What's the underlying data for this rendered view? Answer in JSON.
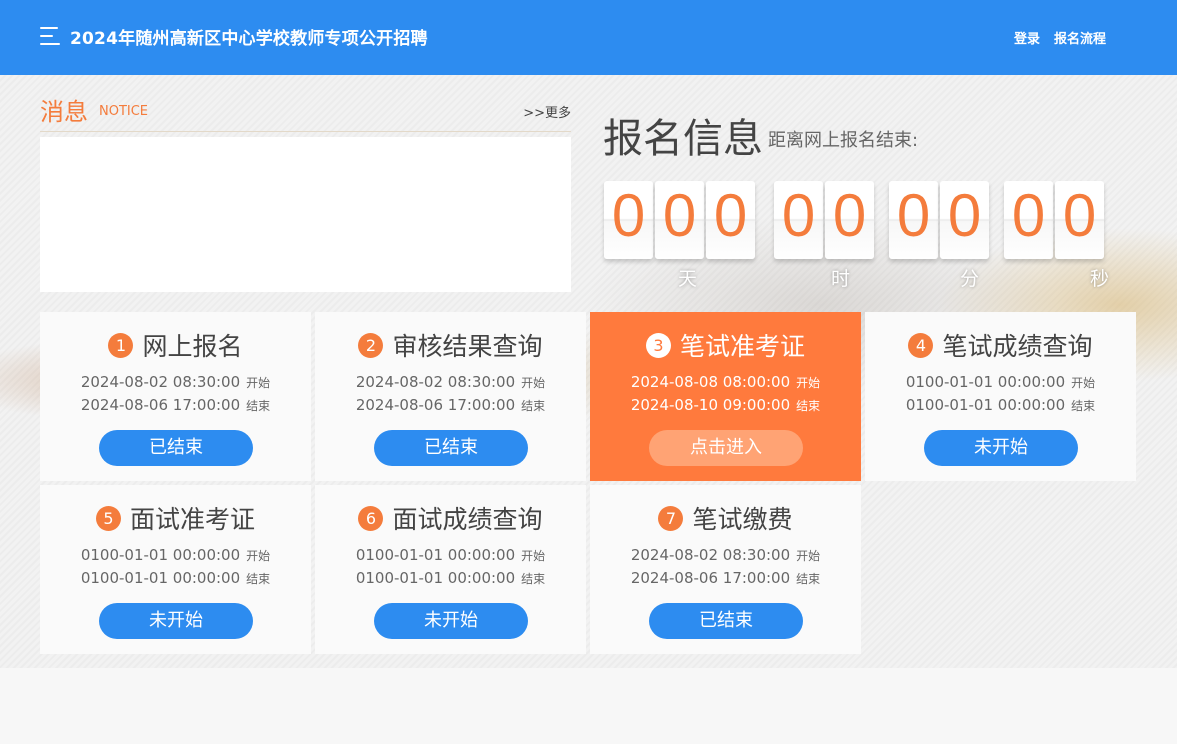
{
  "header": {
    "menu_icon": "hamburger-menu-icon",
    "title": "2024年随州高新区中心学校教师专项公开招聘",
    "login_label": "登录",
    "process_label": "报名流程",
    "bar_color": "#2d8cf0"
  },
  "notice": {
    "title": "消息",
    "subtitle": "NOTICE",
    "more_label": ">>更多"
  },
  "registration": {
    "title": "报名信息",
    "subtitle": "距离网上报名结束:",
    "countdown": {
      "days": [
        "0",
        "0",
        "0"
      ],
      "hours": [
        "0",
        "0"
      ],
      "minutes": [
        "0",
        "0"
      ],
      "seconds": [
        "0",
        "0"
      ],
      "unit_days": "天",
      "unit_hours": "时",
      "unit_minutes": "分",
      "unit_seconds": "秒"
    }
  },
  "start_tag": "开始",
  "end_tag": "结束",
  "accent_color": "#f47c3c",
  "steps": [
    {
      "num": "1",
      "name": "网上报名",
      "start": "2024-08-02 08:30:00",
      "end": "2024-08-06 17:00:00",
      "button": "已结束",
      "active": false
    },
    {
      "num": "2",
      "name": "审核结果查询",
      "start": "2024-08-02 08:30:00",
      "end": "2024-08-06 17:00:00",
      "button": "已结束",
      "active": false
    },
    {
      "num": "3",
      "name": "笔试准考证",
      "start": "2024-08-08 08:00:00",
      "end": "2024-08-10 09:00:00",
      "button": "点击进入",
      "active": true
    },
    {
      "num": "4",
      "name": "笔试成绩查询",
      "start": "0100-01-01 00:00:00",
      "end": "0100-01-01 00:00:00",
      "button": "未开始",
      "active": false
    },
    {
      "num": "5",
      "name": "面试准考证",
      "start": "0100-01-01 00:00:00",
      "end": "0100-01-01 00:00:00",
      "button": "未开始",
      "active": false
    },
    {
      "num": "6",
      "name": "面试成绩查询",
      "start": "0100-01-01 00:00:00",
      "end": "0100-01-01 00:00:00",
      "button": "未开始",
      "active": false
    },
    {
      "num": "7",
      "name": "笔试缴费",
      "start": "2024-08-02 08:30:00",
      "end": "2024-08-06 17:00:00",
      "button": "已结束",
      "active": false
    }
  ]
}
